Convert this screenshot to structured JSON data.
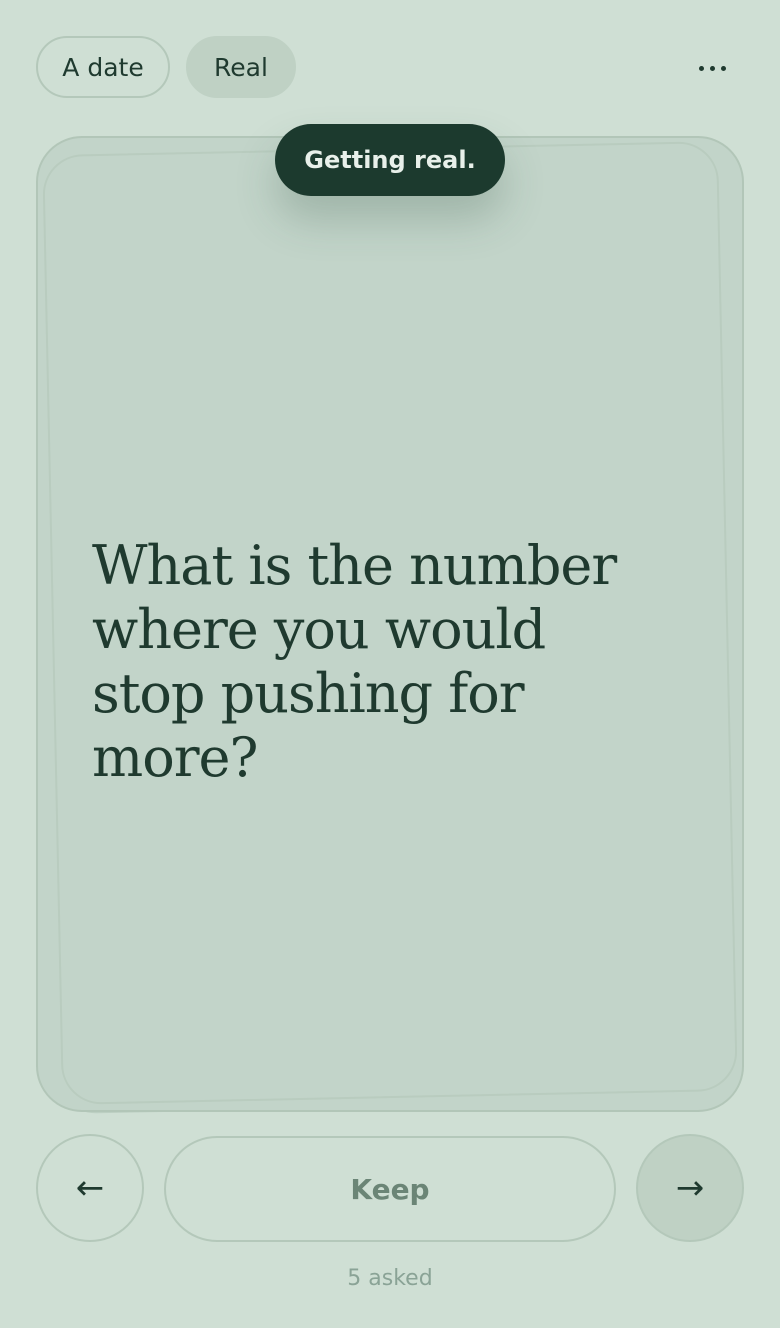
{
  "topbar": {
    "chips": [
      {
        "label": "A date",
        "selected": false
      },
      {
        "label": "Real",
        "selected": true
      }
    ],
    "more_icon": "more-horizontal-icon"
  },
  "toast": {
    "text": "Getting real."
  },
  "card": {
    "question": "What is the number where you would stop pushing for more?"
  },
  "controls": {
    "prev_glyph": "←",
    "keep_label": "Keep",
    "next_glyph": "→"
  },
  "footer": {
    "asked_text": "5 asked"
  },
  "colors": {
    "background": "#cfdfd4",
    "card": "#c2d4c9",
    "accent_dark": "#1c3a2e",
    "text": "#1f3a2f",
    "muted": "#8aa396"
  }
}
